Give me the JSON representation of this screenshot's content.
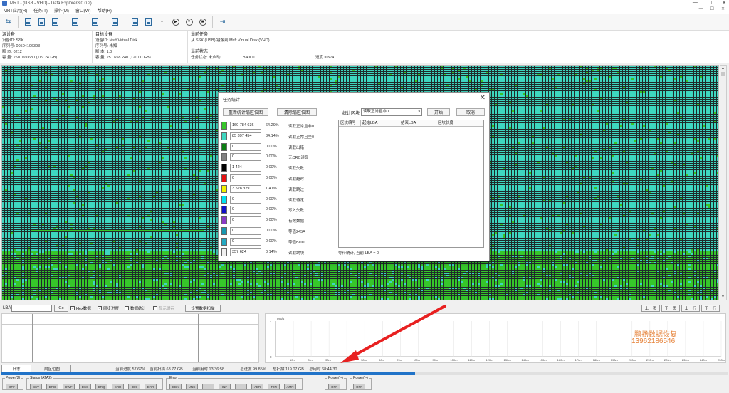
{
  "window": {
    "title": "MRT - (USB - VHD) - Data Explorer8.0.0.2)"
  },
  "window_buttons": [
    "—",
    "☐",
    "✕"
  ],
  "menu": [
    "MRT应用(R)",
    "任务(T)",
    "操作(M)",
    "窗口(W)",
    "帮助(H)"
  ],
  "mdi_buttons": [
    "—",
    "☐",
    "✕"
  ],
  "toolbar": {
    "icons": [
      "usb-icon",
      "doc-icon",
      "doc-icon",
      "doc-icon",
      "edit-icon",
      "disk-icon",
      "tree-icon",
      "copy-icon",
      "search-icon",
      "play-icon",
      "pause-icon",
      "stop-icon",
      "exit-icon"
    ],
    "play": "▶",
    "pause": "⏸",
    "stop": "■",
    "dropdown": "▾"
  },
  "source": {
    "header": "源设备",
    "id": "设备ID: SSK",
    "serial": "序列号: 00504106393",
    "version": "版  本: 0212",
    "capacity": "容  量: 250 069 680 (119.24 GB)"
  },
  "target": {
    "header": "目标设备",
    "id": "设备ID: Msft Virtual Disk",
    "serial": "序列号: 未知",
    "version": "版  本: 1.0",
    "capacity": "容  量: 251 658 240 (120.00 GB)"
  },
  "task": {
    "header": "当前任务",
    "line": "从 SSK (USB) 镜像到 Msft Virtual Disk (VHD)",
    "status_header": "当前状态",
    "status": "任务状态: 未启动",
    "lba": "LBA = 0",
    "speed": "速度 = N/A"
  },
  "sector_map": {
    "colors": {
      "cyan": "#3ed6c0",
      "green": "#36c62a",
      "dark": "#1f2a2a",
      "yellow": "#f2f200"
    }
  },
  "dialog": {
    "title": "任务统计",
    "close": "✕",
    "btn_reset": "重新统计扇区位图",
    "btn_clear": "清除扇区位图",
    "stat_label": "统计区块",
    "select_value": "读取正常且非0",
    "btn_start": "开始",
    "btn_cancel": "取消",
    "table_headers": [
      "区块编号",
      "起始LBA",
      "结束LBA",
      "区块长度"
    ],
    "status": "等待统计, 当前 LBA = 0",
    "legend": [
      {
        "color": "#36c62a",
        "count": "160 784 636",
        "pct": "64.29%",
        "label": "读取正常且非0"
      },
      {
        "color": "#3ed6c0",
        "count": "85 397 454",
        "pct": "34.14%",
        "label": "读取正常且全0"
      },
      {
        "color": "#0a7d12",
        "count": "0",
        "pct": "0.00%",
        "label": "读取出错"
      },
      {
        "color": "#808080",
        "count": "0",
        "pct": "0.00%",
        "label": "无CRC读取"
      },
      {
        "color": "#000000",
        "count": "1 424",
        "pct": "0.00%",
        "label": "读取失败"
      },
      {
        "color": "#e61010",
        "count": "0",
        "pct": "0.00%",
        "label": "读取超时"
      },
      {
        "color": "#f2f200",
        "count": "3 528 329",
        "pct": "1.41%",
        "label": "读取跳过"
      },
      {
        "color": "#00e0f0",
        "count": "0",
        "pct": "0.00%",
        "label": "读取待定"
      },
      {
        "color": "#1010c8",
        "count": "0",
        "pct": "0.00%",
        "label": "写入失败"
      },
      {
        "color": "#8a3ac6",
        "count": "0",
        "pct": "0.00%",
        "label": "有效数据"
      },
      {
        "color": "#1696b0",
        "count": "0",
        "pct": "0.00%",
        "label": "等值245A"
      },
      {
        "color": "#23a9c3",
        "count": "0",
        "pct": "0.00%",
        "label": "等值BDU"
      },
      {
        "color": "#f0f0f0",
        "count": "357 624",
        "pct": "0.14%",
        "label": "读取跳块"
      }
    ]
  },
  "lba_row": {
    "label": "LBA",
    "go": "Go",
    "hex": "Hex数据",
    "hex_checked": "✓",
    "sync": "同步进度",
    "sync_checked": "✓",
    "data_stat": "数据统计",
    "visible": "显示缓存",
    "set_scan": "设置数据扫描",
    "prev_page": "上一页",
    "next_page": "下一页",
    "prev_line": "上一行",
    "next_line": "下一行"
  },
  "speed_chart": {
    "y_label": "MB/s",
    "y_top": "1",
    "y_zero": "0",
    "ticks": [
      "10m",
      "20m",
      "30m",
      "40m",
      "50m",
      "60m",
      "70m",
      "80m",
      "90m",
      "100m",
      "110m",
      "120m",
      "130m",
      "140m",
      "150m",
      "160m",
      "170m",
      "180m",
      "190m",
      "200m",
      "210m",
      "220m",
      "230m",
      "240m",
      "250m"
    ]
  },
  "watermark": {
    "line1": "鹏扬数据恢复",
    "line2": "13962186546"
  },
  "status_row": {
    "tab_log": "日志",
    "tab_region": "扇区位图",
    "current_progress": "当前进度 57.67%",
    "current_scan": "当前扫描 68.77 GB",
    "current_time": "当前用时 13:36:58",
    "total_progress": "总进度 99.85%",
    "total_scan": "总扫描 119.07 GB",
    "total_time": "总用时 68:44:30",
    "progress_fraction": 0.57
  },
  "leds": {
    "power2": {
      "label": "Power(2)",
      "items": [
        "OFF"
      ]
    },
    "status": {
      "label": "Status (ATA2)",
      "items": [
        "BSY",
        "DRD",
        "DWF",
        "DSC",
        "DRQ",
        "CRR",
        "IDX",
        "ERR"
      ]
    },
    "error": {
      "label": "Error",
      "items": [
        "BBK",
        "UNC",
        "",
        "INF",
        "",
        "ABR",
        "T0N",
        "AMN"
      ]
    },
    "power_a": {
      "label": "Power(--)",
      "items": [
        "OFF"
      ]
    },
    "power_b": {
      "label": "Power(--)",
      "items": [
        "OFF"
      ]
    }
  }
}
